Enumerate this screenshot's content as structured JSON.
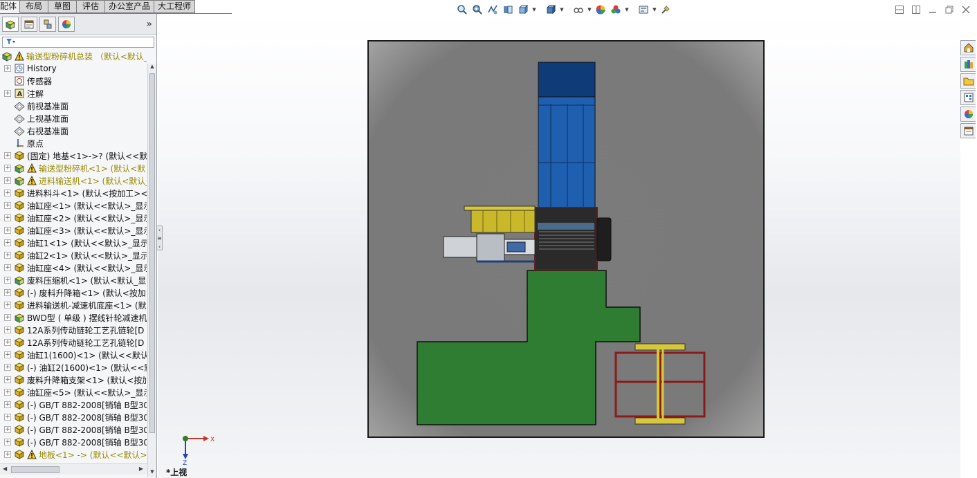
{
  "command_tabs": [
    "配体",
    "布局",
    "草图",
    "评估",
    "办公室产品",
    "大工程师"
  ],
  "hud_icons": [
    "zoom-to-fit-icon",
    "zoom-area-icon",
    "previous-view-icon",
    "section-view-icon",
    "view-orientation-icon",
    "display-style-icon",
    "hide-show-icon",
    "edit-appearance-icon",
    "apply-scene-icon",
    "view-settings-icon",
    "realview-icon"
  ],
  "window_controls": [
    "tile-horizontal-icon",
    "tile-vertical-icon",
    "minimize-icon",
    "restore-icon",
    "close-icon"
  ],
  "fm_tabs": [
    "featuremanager-tab-icon",
    "propertymanager-tab-icon",
    "configurationmanager-tab-icon",
    "displaymanager-tab-icon"
  ],
  "fm_more": "»",
  "tree": {
    "root": "输送型粉碎机总装 （默认<默认_",
    "items": [
      {
        "label": "History",
        "icon": "history-icon",
        "exp": true
      },
      {
        "label": "传感器",
        "icon": "sensor-icon",
        "exp": false
      },
      {
        "label": "注解",
        "icon": "annotation-icon",
        "exp": true
      },
      {
        "label": "前视基准面",
        "icon": "plane-icon",
        "exp": false
      },
      {
        "label": "上视基准面",
        "icon": "plane-icon",
        "exp": false
      },
      {
        "label": "右视基准面",
        "icon": "plane-icon",
        "exp": false
      },
      {
        "label": "原点",
        "icon": "origin-icon",
        "exp": false
      },
      {
        "label": "(固定) 地基<1>->? (默认<<默",
        "icon": "part-icon",
        "exp": true
      },
      {
        "label": "输送型粉碎机<1> (默认<默",
        "icon": "subassembly-icon",
        "exp": true,
        "warn": true
      },
      {
        "label": "进料输送机<1> (默认<默认_",
        "icon": "subassembly-icon",
        "exp": true,
        "warn": true
      },
      {
        "label": "进料料斗<1> (默认<按加工><",
        "icon": "part-icon",
        "exp": true
      },
      {
        "label": "油缸座<1> (默认<<默认>_显示",
        "icon": "part-icon",
        "exp": true
      },
      {
        "label": "油缸座<2> (默认<<默认>_显示",
        "icon": "part-icon",
        "exp": true
      },
      {
        "label": "油缸座<3> (默认<<默认>_显示",
        "icon": "part-icon",
        "exp": true
      },
      {
        "label": "油缸1<1> (默认<<默认>_显示",
        "icon": "part-icon",
        "exp": true
      },
      {
        "label": "油缸2<1> (默认<<默认>_显示",
        "icon": "part-icon",
        "exp": true
      },
      {
        "label": "油缸座<4> (默认<<默认>_显示",
        "icon": "part-icon",
        "exp": true
      },
      {
        "label": "废料压缩机<1> (默认<默认_显",
        "icon": "subassembly-icon",
        "exp": true
      },
      {
        "label": "(-) 废料升降箱<1> (默认<按加",
        "icon": "part-icon",
        "exp": true
      },
      {
        "label": "进料输送机-减速机底座<1> (默",
        "icon": "part-icon",
        "exp": true
      },
      {
        "label": "BWD型 ( 单级 ) 摆线针轮减速机",
        "icon": "subassembly-icon",
        "exp": true
      },
      {
        "label": "12A系列传动链轮工艺孔链轮[D",
        "icon": "part-icon",
        "exp": true
      },
      {
        "label": "12A系列传动链轮工艺孔链轮[D",
        "icon": "part-icon",
        "exp": true
      },
      {
        "label": "油缸1(1600)<1> (默认<<默认",
        "icon": "part-icon",
        "exp": true
      },
      {
        "label": "(-) 油缸2(1600)<1> (默认<<默",
        "icon": "part-icon",
        "exp": true
      },
      {
        "label": "废料升降箱支架<1> (默认<按加",
        "icon": "part-icon",
        "exp": true
      },
      {
        "label": "油缸座<5> (默认<<默认>_显示",
        "icon": "part-icon",
        "exp": true
      },
      {
        "label": "(-) GB/T 882-2008[销轴 B型30",
        "icon": "part-icon",
        "exp": true
      },
      {
        "label": "(-) GB/T 882-2008[销轴 B型30",
        "icon": "part-icon",
        "exp": true
      },
      {
        "label": "(-) GB/T 882-2008[销轴 B型30",
        "icon": "part-icon",
        "exp": true
      },
      {
        "label": "(-) GB/T 882-2008[销轴 B型30",
        "icon": "part-icon",
        "exp": true
      },
      {
        "label": "地板<1> -> (默认<<默认>_",
        "icon": "part-icon",
        "exp": true,
        "warn": true
      }
    ]
  },
  "triad": {
    "x": "X",
    "z": "Z"
  },
  "view_label": "*上视",
  "task_pane": [
    "resources-icon",
    "design-library-icon",
    "file-explorer-icon",
    "view-palette-icon",
    "appearances-icon",
    "custom-properties-icon"
  ]
}
